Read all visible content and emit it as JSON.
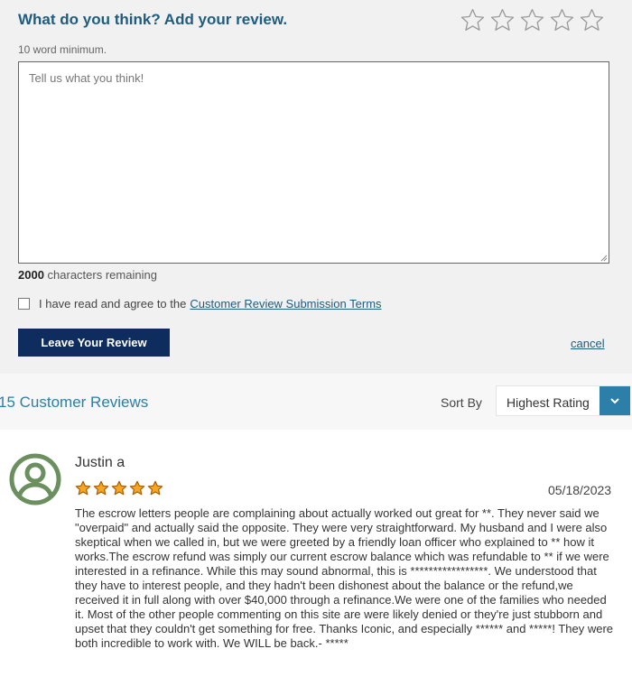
{
  "review_form": {
    "title": "What do you think? Add your review.",
    "star_count": 5,
    "min_words_hint": "10 word minimum.",
    "textarea_placeholder": "Tell us what you think!",
    "textarea_value": "",
    "chars_remaining_count": "2000",
    "chars_remaining_suffix": " characters remaining",
    "terms_checked": false,
    "terms_text": "I have read and agree to the",
    "terms_link": "Customer Review Submission Terms",
    "submit_label": "Leave Your Review",
    "cancel_label": "cancel"
  },
  "reviews_header": {
    "count_label": "15 Customer Reviews",
    "sort_label": "Sort By",
    "sort_value": "Highest Rating"
  },
  "reviews": [
    {
      "author": "Justin a",
      "rating": 5,
      "date": "05/18/2023",
      "body": "The escrow letters people are complaining about actually worked out great for **. They never said we \"overpaid\" and actually said the opposite. They were very straightforward. My husband and I were also skeptical when we called in, but we were greeted by a friendly loan officer who explained to ** how it works.The escrow refund was simply our current escrow balance which was refundable to ** if we were interested in a refinance. While this may sound abnormal, this is *****************. We understood that they have to interest people, and they hadn't been dishonest about the balance or the refund,we received it in full along with over $40,000 through a refinance.We were one of the families who needed it. Most of the other people commenting on this site are were likely denied or they're just stubborn and upset that they couldn't get something for free. Thanks Iconic, and especially ****** and *****! They were both incredible to work with. We WILL be back.- *****"
    }
  ],
  "colors": {
    "title_blue": "#1e5d80",
    "accent_blue": "#2b7fa8",
    "button_navy": "#0e2d5e",
    "star_gold": "#f6a623",
    "avatar_green": "#6b8f5e"
  },
  "icons": {
    "rating_input": "star-outline-icon",
    "rating_display": "star-filled-icon",
    "sort": "chevron-down-icon",
    "avatar": "user-silhouette-icon"
  }
}
